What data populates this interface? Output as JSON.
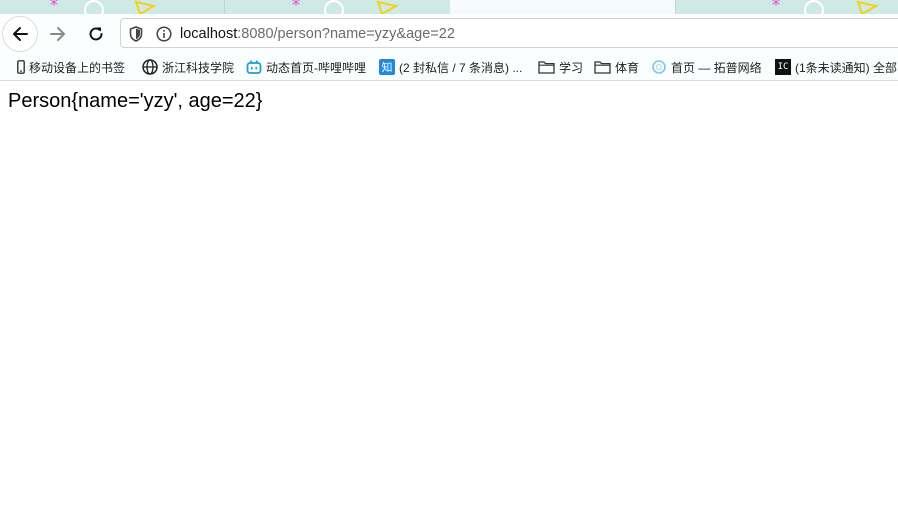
{
  "browser": {
    "address_bar": {
      "host": "localhost",
      "path": ":8080/person?name=yzy&age=22"
    },
    "icons": {
      "back": "arrow-left-icon",
      "forward": "arrow-right-icon",
      "reload": "reload-icon",
      "tracking": "shield-icon",
      "site_info": "info-icon"
    },
    "colors": {
      "tab_strip": "#cfe9e6",
      "toolbar": "#fbfefe",
      "accent_blue": "#1e88e5"
    }
  },
  "bookmarks": [
    {
      "label": "移动设备上的书签",
      "icon": "mobile-icon"
    },
    {
      "label": "浙江科技学院",
      "icon": "globe-icon"
    },
    {
      "label": "动态首页-哔哩哔哩",
      "icon": "bilibili-icon"
    },
    {
      "label": "(2 封私信 / 7 条消息) ...",
      "icon": "zhihu-icon"
    },
    {
      "label": "学习",
      "icon": "folder-icon"
    },
    {
      "label": "体育",
      "icon": "folder-icon"
    },
    {
      "label": "首页 — 拓普网络",
      "icon": "topu-icon"
    },
    {
      "label": "(1条未读通知) 全部",
      "icon": "notification-site-icon"
    }
  ],
  "page": {
    "body_text": "Person{name='yzy', age=22}"
  }
}
